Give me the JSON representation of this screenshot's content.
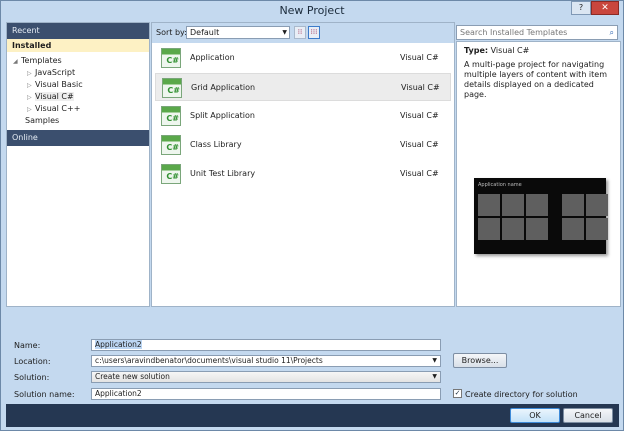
{
  "window": {
    "title": "New Project",
    "help": "?",
    "close": "✕"
  },
  "sidebar": {
    "recent": "Recent",
    "installed": "Installed",
    "templates": "Templates",
    "languages": [
      "JavaScript",
      "Visual Basic",
      "Visual C#",
      "Visual C++"
    ],
    "samples": "Samples",
    "online": "Online"
  },
  "sort": {
    "label": "Sort by:",
    "value": "Default"
  },
  "search": {
    "placeholder": "Search Installed Templates"
  },
  "templates": [
    {
      "name": "Application",
      "lang": "Visual C#"
    },
    {
      "name": "Grid Application",
      "lang": "Visual C#"
    },
    {
      "name": "Split Application",
      "lang": "Visual C#"
    },
    {
      "name": "Class Library",
      "lang": "Visual C#"
    },
    {
      "name": "Unit Test Library",
      "lang": "Visual C#"
    }
  ],
  "details": {
    "type_label": "Type:",
    "type_value": "Visual C#",
    "description": "A multi-page project for navigating multiple layers of content with item details displayed on a dedicated page.",
    "preview_title": "Application name"
  },
  "form": {
    "name_label": "Name:",
    "name_value": "Application2",
    "location_label": "Location:",
    "location_value": "c:\\users\\aravindbenator\\documents\\visual studio 11\\Projects",
    "browse": "Browse...",
    "solution_label": "Solution:",
    "solution_value": "Create new solution",
    "solution_name_label": "Solution name:",
    "solution_name_value": "Application2",
    "create_dir": "Create directory for solution",
    "create_dir_checked": true
  },
  "buttons": {
    "ok": "OK",
    "cancel": "Cancel"
  }
}
